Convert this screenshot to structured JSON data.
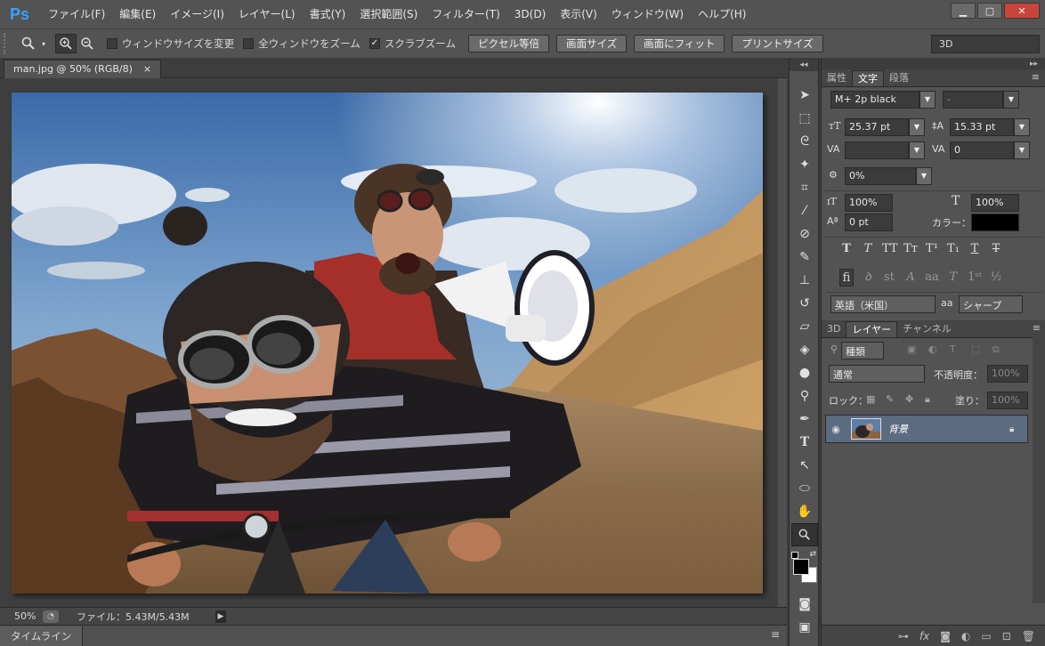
{
  "app": {
    "logo": "Ps"
  },
  "menu": [
    "ファイル(F)",
    "編集(E)",
    "イメージ(I)",
    "レイヤー(L)",
    "書式(Y)",
    "選択範囲(S)",
    "フィルター(T)",
    "3D(D)",
    "表示(V)",
    "ウィンドウ(W)",
    "ヘルプ(H)"
  ],
  "window_buttons": {
    "minimize": "▁",
    "maximize": "▢",
    "close": "✕"
  },
  "options": {
    "resize_windows": "ウィンドウサイズを変更",
    "resize_checked": "",
    "zoom_all": "全ウィンドウをズーム",
    "zoom_all_checked": "",
    "scrubby": "スクラブズーム",
    "scrubby_checked": "✓",
    "actual_pixels": "ピクセル等倍",
    "fit_screen": "画面サイズ",
    "fill_screen": "画面にフィット",
    "print_size": "プリントサイズ",
    "workspace": "3D"
  },
  "document": {
    "tab_title": "man.jpg @ 50% (RGB/8)",
    "tab_close": "×"
  },
  "status": {
    "zoom": "50%",
    "file_info": "ファイル：5.43M/5.43M",
    "arrow": "▶"
  },
  "timeline": {
    "label": "タイムライン"
  },
  "char_panel": {
    "tabs": [
      "属性",
      "文字",
      "段落"
    ],
    "font_family": "M+ 2p black",
    "font_style": "-",
    "font_size": "25.37 pt",
    "leading": "15.33 pt",
    "kerning": "",
    "tracking": "0",
    "tsume": "0%",
    "vscale": "100%",
    "hscale": "100%",
    "baseline": "0 pt",
    "color_label": "カラー：",
    "color": "#000000",
    "language": "英語（米国）",
    "aa_label": "aa",
    "antialias": "シャープ"
  },
  "layers_panel": {
    "tabs": [
      "3D",
      "レイヤー",
      "チャンネル"
    ],
    "filter_kind": "種類",
    "blend_mode": "通常",
    "opacity_label": "不透明度：",
    "opacity": "100%",
    "lock_label": "ロック：",
    "fill_label": "塗り：",
    "fill": "100%",
    "layer_name": "背景"
  }
}
